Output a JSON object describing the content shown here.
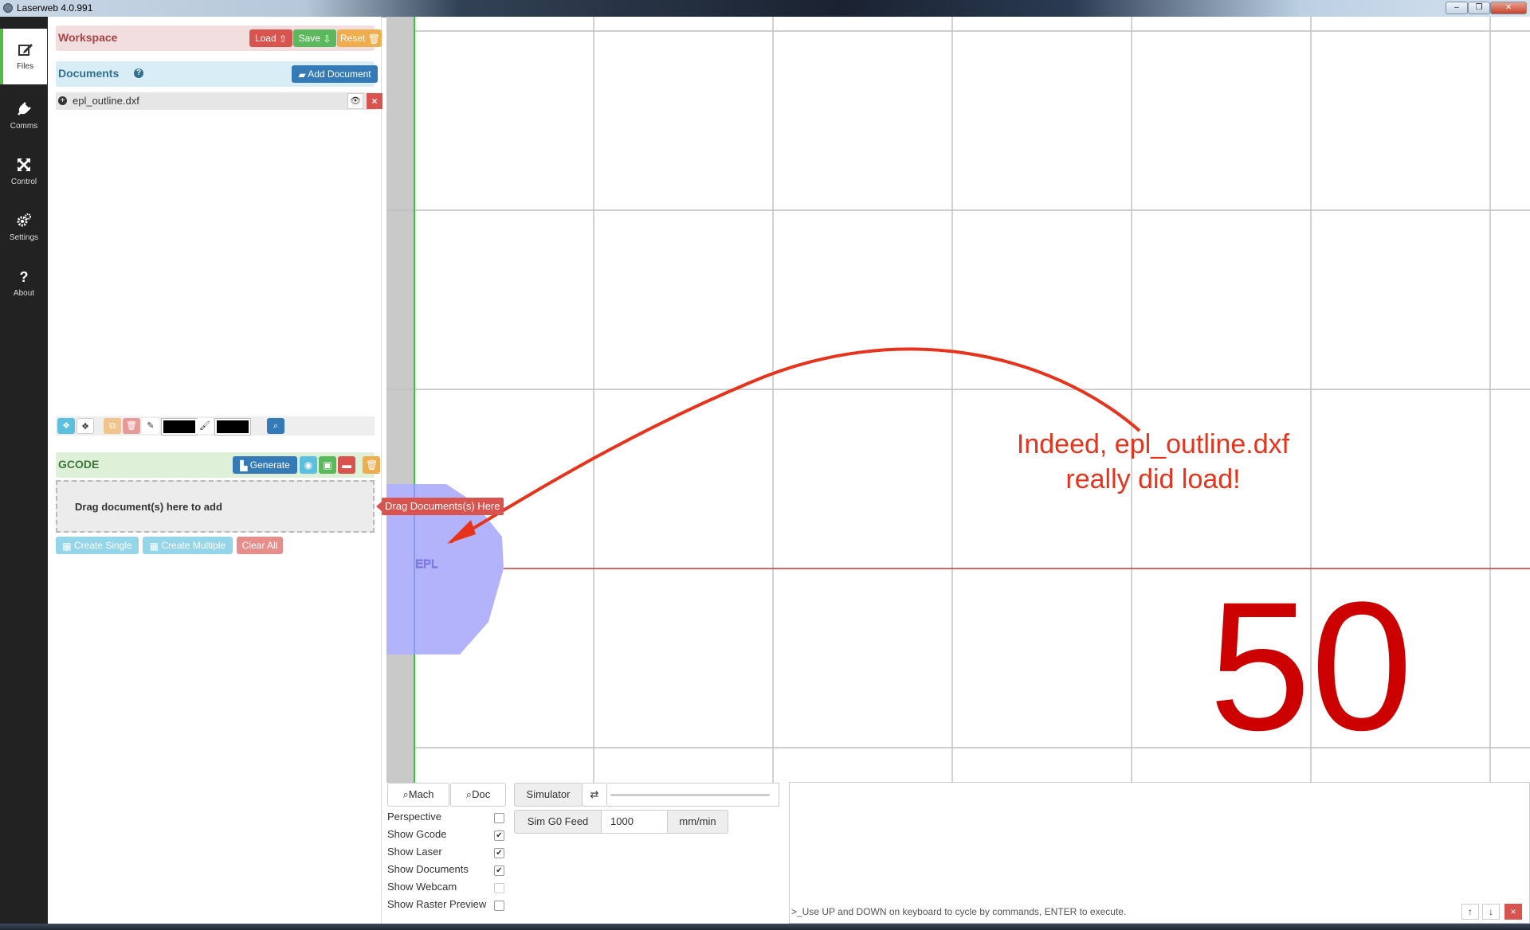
{
  "window": {
    "title": "Laserweb 4.0.991",
    "minimize": "–",
    "restore": "❐",
    "close": "✕"
  },
  "sidebar": {
    "items": [
      {
        "label": "Files",
        "icon": "edit-icon"
      },
      {
        "label": "Comms",
        "icon": "plug-icon"
      },
      {
        "label": "Control",
        "icon": "arrows-icon"
      },
      {
        "label": "Settings",
        "icon": "gears-icon"
      },
      {
        "label": "About",
        "icon": "question-icon"
      }
    ]
  },
  "workspace": {
    "title": "Workspace",
    "load": "Load",
    "save": "Save",
    "reset": "Reset"
  },
  "documents": {
    "title": "Documents",
    "help": "?",
    "add_label": "Add Document",
    "items": [
      {
        "name": "epl_outline.dxf"
      }
    ]
  },
  "gcode": {
    "title": "GCODE",
    "generate": "Generate",
    "drop_text": "Drag document(s) here to add",
    "tooltip": "Drag Documents(s) Here",
    "create_single": "Create Single",
    "create_multiple": "Create Multiple",
    "clear_all": "Clear All"
  },
  "viewport": {
    "annotation_line1": "Indeed, epl_outline.dxf",
    "annotation_line2": "really did load!",
    "scale_label": "50",
    "shape_label": "EPL",
    "colors": {
      "annotation": "#e8331c",
      "scale": "#cc0000",
      "doc_fill": "#b3b3fb",
      "x_axis": "#cc3333",
      "y_axis": "#33cc33"
    }
  },
  "controls": {
    "mach": "Mach",
    "doc": "Doc",
    "simulator": "Simulator",
    "sim_feed_label": "Sim G0 Feed",
    "sim_feed_value": "1000",
    "sim_feed_unit": "mm/min",
    "options": [
      {
        "label": "Perspective",
        "checked": false
      },
      {
        "label": "Show Gcode",
        "checked": true
      },
      {
        "label": "Show Laser",
        "checked": true
      },
      {
        "label": "Show Documents",
        "checked": true
      },
      {
        "label": "Show Webcam",
        "checked": false
      },
      {
        "label": "Show Raster Preview",
        "checked": false
      }
    ]
  },
  "console": {
    "hint": ">_Use UP and DOWN on keyboard to cycle by commands, ENTER to execute."
  }
}
